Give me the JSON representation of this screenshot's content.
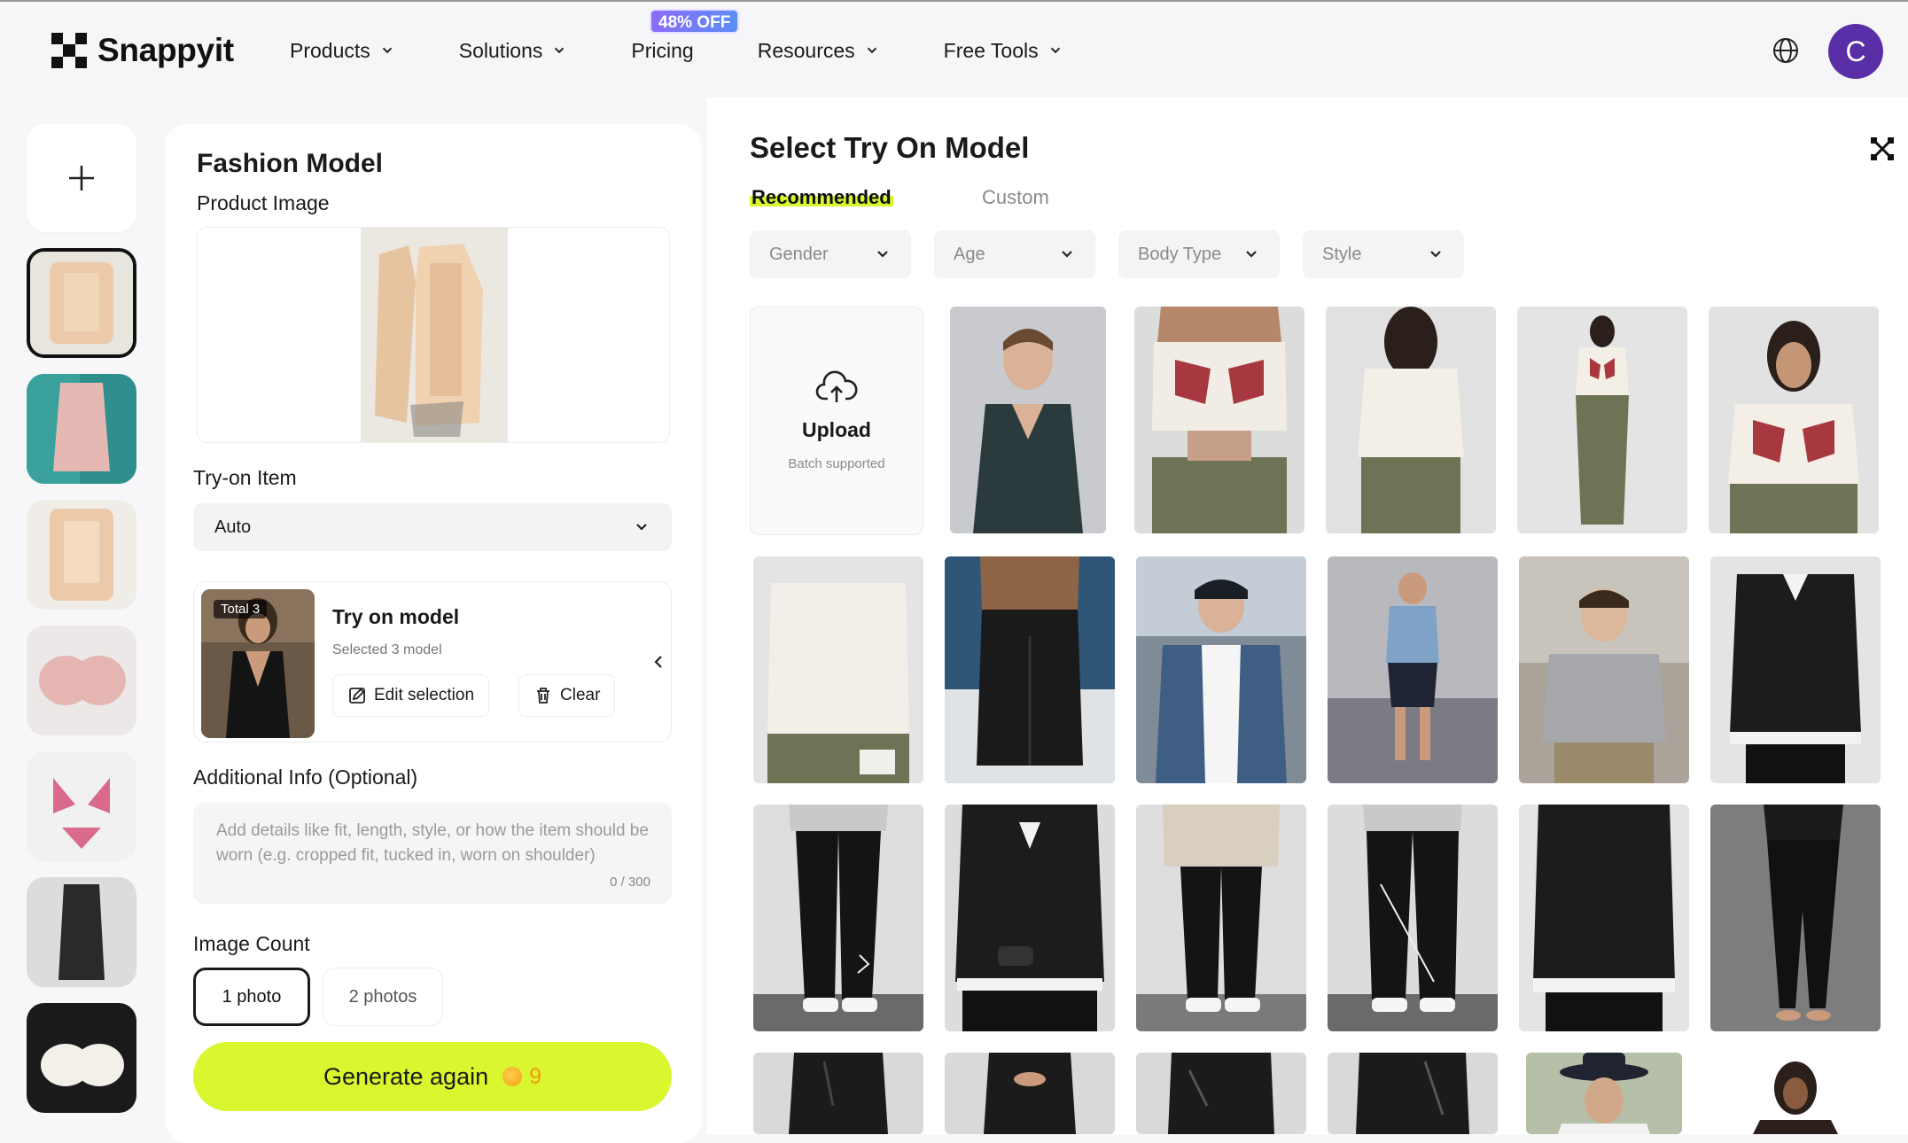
{
  "nav": {
    "brand": "Snappyit",
    "items": [
      {
        "label": "Products",
        "dropdown": true
      },
      {
        "label": "Solutions",
        "dropdown": true
      },
      {
        "label": "Pricing",
        "dropdown": false
      },
      {
        "label": "Resources",
        "dropdown": true
      },
      {
        "label": "Free Tools",
        "dropdown": true
      }
    ],
    "pricing_badge": "48% OFF",
    "avatar_initial": "C"
  },
  "form": {
    "title": "Fashion Model",
    "product_image_label": "Product Image",
    "tryon_item_label": "Try-on Item",
    "tryon_item_value": "Auto",
    "model_card": {
      "total_badge": "Total 3",
      "title": "Try on model",
      "subtitle": "Selected 3 model",
      "edit_label": "Edit selection",
      "clear_label": "Clear"
    },
    "additional_label": "Additional Info (Optional)",
    "additional_placeholder": "Add details like fit, length, style, or how the item should be worn (e.g. cropped fit, tucked in, worn on shoulder)",
    "additional_counter": "0 / 300",
    "image_count_label": "Image Count",
    "count_options": [
      "1 photo",
      "2 photos"
    ],
    "generate_label": "Generate again",
    "generate_credits": "9"
  },
  "select_panel": {
    "title": "Select Try On Model",
    "tabs": [
      "Recommended",
      "Custom"
    ],
    "filters": [
      "Gender",
      "Age",
      "Body Type",
      "Style"
    ],
    "upload_title": "Upload",
    "upload_subtitle": "Batch supported"
  },
  "colors": {
    "accent_lime": "#d9f62f",
    "avatar_purple": "#5a2ea6",
    "badge_gradient_start": "#8b6cf7",
    "badge_gradient_end": "#5b8ef7"
  }
}
